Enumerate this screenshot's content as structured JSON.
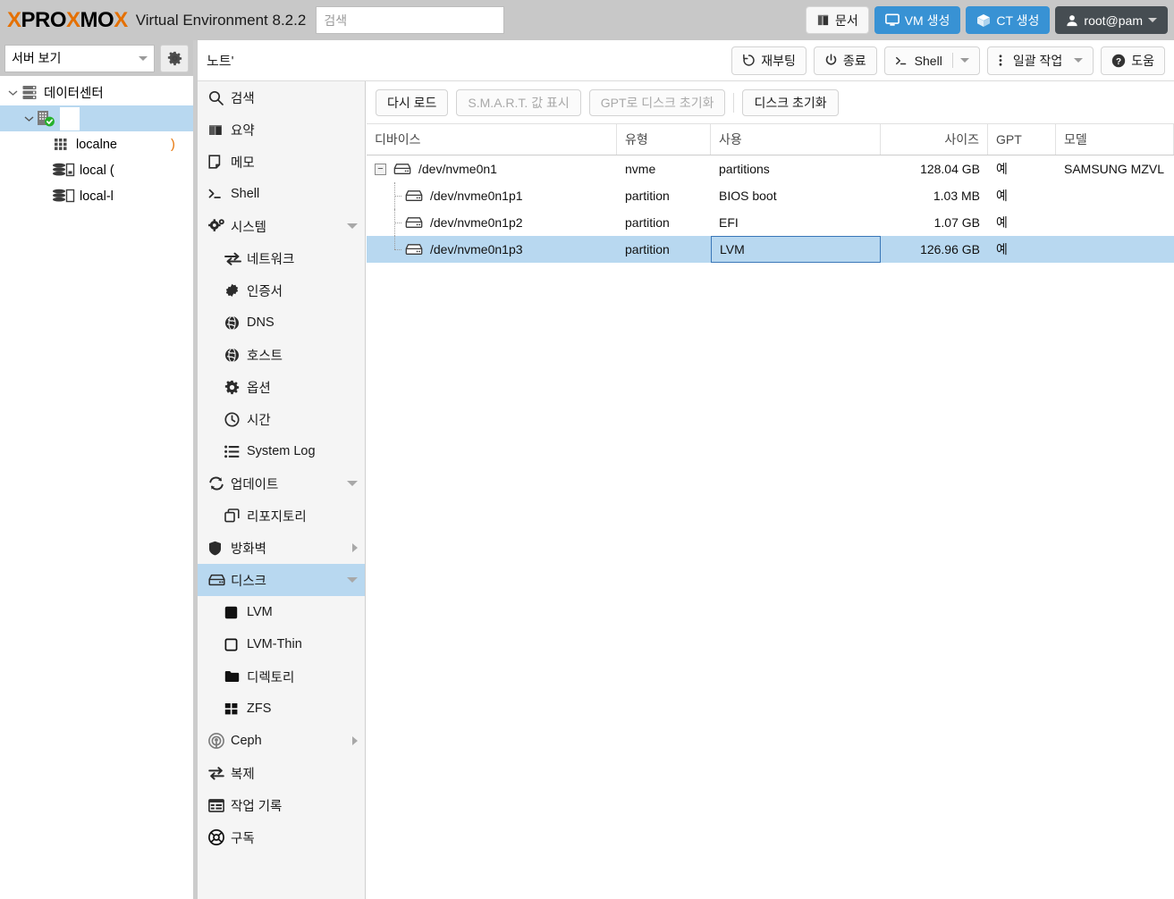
{
  "header": {
    "logo_x": "X",
    "logo_pro": "PRO",
    "logo_x2": "X",
    "logo_mo": "MO",
    "logo_x3": "X",
    "product": "Virtual Environment 8.2.2",
    "search_placeholder": "검색",
    "search_value": "",
    "buttons": {
      "docs": "문서",
      "create_vm": "VM 생성",
      "create_ct": "CT 생성",
      "user": "root@pam"
    }
  },
  "subbar": {
    "title": "노트'",
    "reboot": "재부팅",
    "shutdown": "종료",
    "shell": "Shell",
    "bulk_actions": "일괄 작업",
    "help": "도움"
  },
  "left_pane": {
    "view_selector": "서버 보기",
    "tree": [
      {
        "label": "데이터센터",
        "level": 0,
        "expanded": true,
        "icon": "datacenter-icon",
        "selected": false
      },
      {
        "label": "",
        "level": 1,
        "expanded": true,
        "icon": "node-icon",
        "selected": true,
        "redacted": true
      },
      {
        "label": "localne",
        "level": 2,
        "icon": "grid-icon",
        "selected": false
      },
      {
        "label": "local (",
        "level": 2,
        "icon": "storage-icon",
        "selected": false
      },
      {
        "label": "local-l",
        "level": 2,
        "icon": "storage-icon",
        "selected": false
      }
    ]
  },
  "nav": {
    "items": [
      {
        "label": "검색",
        "icon": "search-icon",
        "level": 0,
        "expand": "none",
        "selected": false
      },
      {
        "label": "요약",
        "icon": "summary-book-icon",
        "level": 0,
        "expand": "none",
        "selected": false
      },
      {
        "label": "메모",
        "icon": "note-icon",
        "level": 0,
        "expand": "none",
        "selected": false
      },
      {
        "label": "Shell",
        "icon": "terminal-icon",
        "level": 0,
        "expand": "none",
        "selected": false
      },
      {
        "label": "시스템",
        "icon": "gears-icon",
        "level": 0,
        "expand": "down",
        "selected": false
      },
      {
        "label": "네트워크",
        "icon": "network-arrows-icon",
        "level": 1,
        "expand": "none",
        "selected": false
      },
      {
        "label": "인증서",
        "icon": "certificate-icon",
        "level": 1,
        "expand": "none",
        "selected": false
      },
      {
        "label": "DNS",
        "icon": "globe-icon",
        "level": 1,
        "expand": "none",
        "selected": false
      },
      {
        "label": "호스트",
        "icon": "globe-icon",
        "level": 1,
        "expand": "none",
        "selected": false
      },
      {
        "label": "옵션",
        "icon": "gear-icon",
        "level": 1,
        "expand": "none",
        "selected": false
      },
      {
        "label": "시간",
        "icon": "clock-icon",
        "level": 1,
        "expand": "none",
        "selected": false
      },
      {
        "label": "System Log",
        "icon": "list-icon",
        "level": 1,
        "expand": "none",
        "selected": false
      },
      {
        "label": "업데이트",
        "icon": "refresh-icon",
        "level": 0,
        "expand": "down",
        "selected": false
      },
      {
        "label": "리포지토리",
        "icon": "repository-icon",
        "level": 1,
        "expand": "none",
        "selected": false
      },
      {
        "label": "방화벽",
        "icon": "shield-icon",
        "level": 0,
        "expand": "right",
        "selected": false
      },
      {
        "label": "디스크",
        "icon": "disk-icon",
        "level": 0,
        "expand": "down",
        "selected": true
      },
      {
        "label": "LVM",
        "icon": "lvm-filled-square-icon",
        "level": 1,
        "expand": "none",
        "selected": false
      },
      {
        "label": "LVM-Thin",
        "icon": "lvm-thin-square-icon",
        "level": 1,
        "expand": "none",
        "selected": false
      },
      {
        "label": "디렉토리",
        "icon": "folder-icon",
        "level": 1,
        "expand": "none",
        "selected": false
      },
      {
        "label": "ZFS",
        "icon": "zfs-grid-icon",
        "level": 1,
        "expand": "none",
        "selected": false
      },
      {
        "label": "Ceph",
        "icon": "ceph-icon",
        "level": 0,
        "expand": "right",
        "selected": false
      },
      {
        "label": "복제",
        "icon": "replication-icon",
        "level": 0,
        "expand": "none",
        "selected": false
      },
      {
        "label": "작업 기록",
        "icon": "task-history-icon",
        "level": 0,
        "expand": "none",
        "selected": false
      },
      {
        "label": "구독",
        "icon": "subscription-icon",
        "level": 0,
        "expand": "none",
        "selected": false
      }
    ]
  },
  "disk_toolbar": {
    "reload": "다시 로드",
    "show_smart": "S.M.A.R.T. 값 표시",
    "init_gpt": "GPT로 디스크 초기화",
    "wipe_disk": "디스크 초기화"
  },
  "disk_table": {
    "columns": [
      "디바이스",
      "유형",
      "사용",
      "사이즈",
      "GPT",
      "모델"
    ],
    "rows": [
      {
        "device": "/dev/nvme0n1",
        "type": "nvme",
        "usage": "partitions",
        "size": "128.04 GB",
        "gpt": "예",
        "model": "SAMSUNG MZVL",
        "level": 0,
        "selected": false,
        "expanded": true
      },
      {
        "device": "/dev/nvme0n1p1",
        "type": "partition",
        "usage": "BIOS boot",
        "size": "1.03 MB",
        "gpt": "예",
        "model": "",
        "level": 1,
        "selected": false,
        "expanded": false
      },
      {
        "device": "/dev/nvme0n1p2",
        "type": "partition",
        "usage": "EFI",
        "size": "1.07 GB",
        "gpt": "예",
        "model": "",
        "level": 1,
        "selected": false,
        "expanded": false
      },
      {
        "device": "/dev/nvme0n1p3",
        "type": "partition",
        "usage": "LVM",
        "size": "126.96 GB",
        "gpt": "예",
        "model": "",
        "level": 1,
        "selected": true,
        "expanded": false
      }
    ]
  },
  "colors": {
    "brand_orange": "#e57000",
    "accent_blue": "#3892d4",
    "selection_blue": "#b8d8f0",
    "header_gray": "#c8c8c8",
    "cell_focus_border": "#3a77b8"
  }
}
